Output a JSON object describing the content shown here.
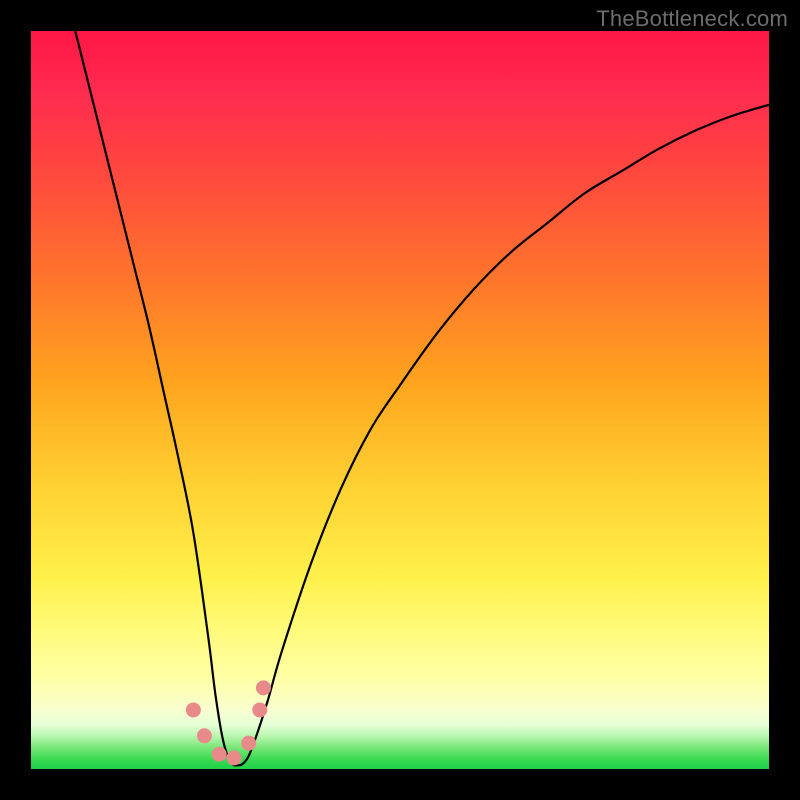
{
  "attribution": "TheBottleneck.com",
  "colors": {
    "frame": "#000000",
    "gradient_top": "#ff1744",
    "gradient_mid": "#ffd233",
    "gradient_bottom": "#1ed04a",
    "curve": "#000000",
    "marker_fill": "#e88a8a",
    "marker_stroke": "#d87474"
  },
  "chart_data": {
    "type": "line",
    "title": "",
    "xlabel": "",
    "ylabel": "",
    "xlim": [
      0,
      100
    ],
    "ylim": [
      0,
      100
    ],
    "grid": false,
    "legend": false,
    "series": [
      {
        "name": "bottleneck-curve",
        "x": [
          6,
          8,
          10,
          12,
          14,
          16,
          18,
          20,
          22,
          24,
          25,
          26,
          27,
          28,
          29,
          30,
          32,
          34,
          38,
          42,
          46,
          50,
          55,
          60,
          65,
          70,
          75,
          80,
          85,
          90,
          95,
          100
        ],
        "y": [
          100,
          92,
          84,
          76,
          68,
          60,
          51,
          42,
          32,
          18,
          10,
          4,
          1,
          0.5,
          1,
          3,
          9,
          16,
          28,
          38,
          46,
          52,
          59,
          65,
          70,
          74,
          78,
          81,
          84,
          86.5,
          88.5,
          90
        ]
      }
    ],
    "markers": [
      {
        "x": 22.0,
        "y": 8.0
      },
      {
        "x": 23.5,
        "y": 4.5
      },
      {
        "x": 25.5,
        "y": 2.0
      },
      {
        "x": 27.5,
        "y": 1.5
      },
      {
        "x": 29.5,
        "y": 3.5
      },
      {
        "x": 31.0,
        "y": 8.0
      },
      {
        "x": 31.5,
        "y": 11.0
      }
    ],
    "minimum_x": 27.5,
    "annotations": []
  }
}
